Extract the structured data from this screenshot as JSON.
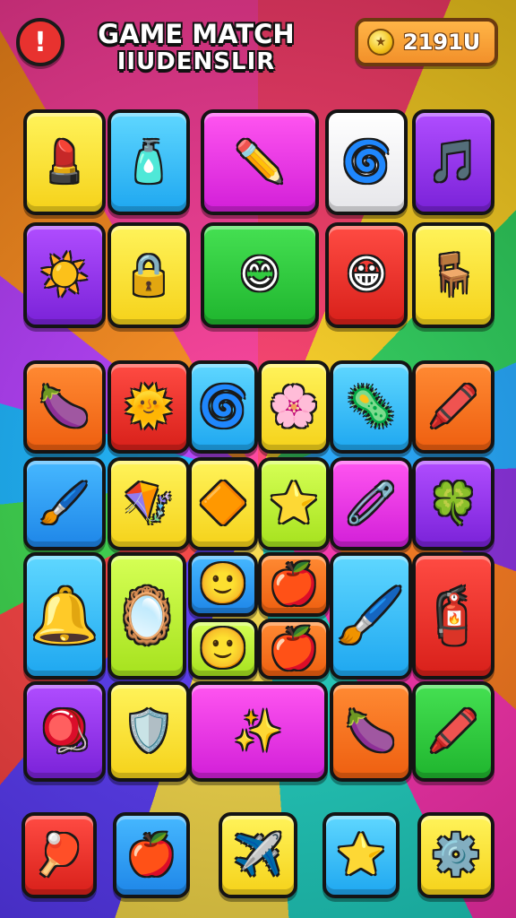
{
  "header": {
    "alert_symbol": "!",
    "title_line1": "GAME MATCH",
    "title_line2": "IIUDENSLIR",
    "coins": "2191U"
  },
  "board": {
    "tiles": [
      {
        "id": "lipstick",
        "color": "yellow",
        "glyph": "💄"
      },
      {
        "id": "bottle",
        "color": "cyan",
        "glyph": "🧴"
      },
      {
        "id": "rocket-pencil",
        "color": "magenta",
        "glyph": "✏️"
      },
      {
        "id": "swirl-hook",
        "color": "white",
        "glyph": "🌀"
      },
      {
        "id": "music-note",
        "color": "purple",
        "glyph": "🎵"
      },
      {
        "id": "sun",
        "color": "purple",
        "glyph": "☀️"
      },
      {
        "id": "lock",
        "color": "yellow",
        "glyph": "🔒"
      },
      {
        "id": "elf-face",
        "color": "green",
        "glyph": "😊"
      },
      {
        "id": "heart-face",
        "color": "red",
        "glyph": "😀"
      },
      {
        "id": "stool",
        "color": "yellow",
        "glyph": "🪑"
      },
      {
        "id": "eggplant",
        "color": "orange",
        "glyph": "🍆"
      },
      {
        "id": "sun-face",
        "color": "red",
        "glyph": "🌞"
      },
      {
        "id": "swirl",
        "color": "cyan",
        "glyph": "🌀"
      },
      {
        "id": "flower",
        "color": "yellow",
        "glyph": "🌸"
      },
      {
        "id": "virus",
        "color": "cyan",
        "glyph": "🦠"
      },
      {
        "id": "crayon",
        "color": "orange",
        "glyph": "🖍️"
      },
      {
        "id": "brush",
        "color": "blue",
        "glyph": "🖌️"
      },
      {
        "id": "kite",
        "color": "yellow",
        "glyph": "🪁"
      },
      {
        "id": "diamond-kite",
        "color": "yellow",
        "glyph": "🔶"
      },
      {
        "id": "wand-star",
        "color": "lime",
        "glyph": "⭐"
      },
      {
        "id": "safety-pin",
        "color": "magenta",
        "glyph": "🧷"
      },
      {
        "id": "blob",
        "color": "purple",
        "glyph": "🍀"
      },
      {
        "id": "bell-scissors",
        "color": "cyan",
        "glyph": "🔔"
      },
      {
        "id": "mirror-cone",
        "color": "lime",
        "glyph": "🪞"
      },
      {
        "id": "face-ball-1",
        "color": "blue",
        "glyph": "🙂"
      },
      {
        "id": "apple-1",
        "color": "orange",
        "glyph": "🍎"
      },
      {
        "id": "face-ball-2",
        "color": "lime",
        "glyph": "🙂"
      },
      {
        "id": "apple-2",
        "color": "orange",
        "glyph": "🍎"
      },
      {
        "id": "paintbrush-cone",
        "color": "cyan",
        "glyph": "🖌️"
      },
      {
        "id": "spray-can",
        "color": "red",
        "glyph": "🧯"
      },
      {
        "id": "rattle-face",
        "color": "purple",
        "glyph": "🪀"
      },
      {
        "id": "sword-shield",
        "color": "yellow",
        "glyph": "🛡️"
      },
      {
        "id": "sparkle-crayon",
        "color": "magenta",
        "glyph": "✨"
      },
      {
        "id": "eggplant-2",
        "color": "orange",
        "glyph": "🍆"
      },
      {
        "id": "crayon-2",
        "color": "green",
        "glyph": "🖍️"
      }
    ]
  },
  "tray": {
    "tiles": [
      {
        "id": "paddle",
        "color": "red",
        "glyph": "🏓"
      },
      {
        "id": "bomb-apple",
        "color": "blue",
        "glyph": "🍎"
      },
      {
        "id": "plane",
        "color": "yellow",
        "glyph": "✈️"
      },
      {
        "id": "star",
        "color": "cyan",
        "glyph": "⭐"
      },
      {
        "id": "gear",
        "color": "yellow",
        "glyph": "⚙️"
      }
    ]
  }
}
